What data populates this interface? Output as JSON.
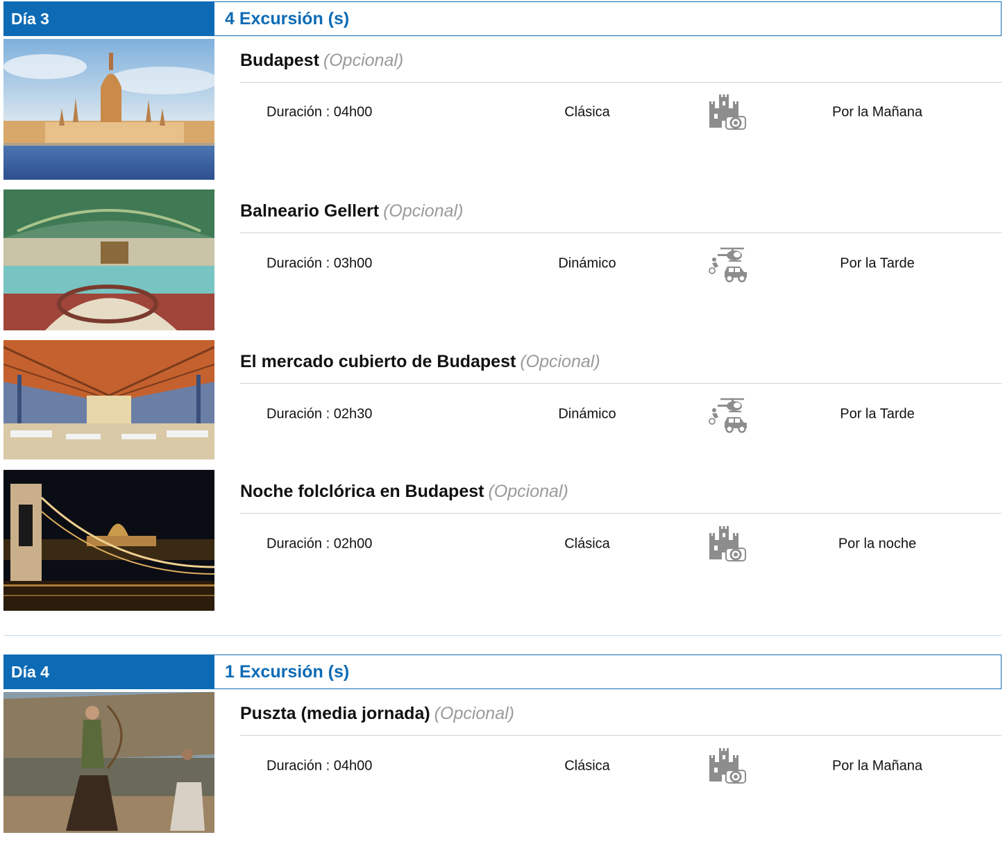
{
  "days": [
    {
      "label": "Día 3",
      "count": "4 Excursión (s)",
      "excursions": [
        {
          "title": "Budapest",
          "optional": "(Opcional)",
          "duration": "Duración : 04h00",
          "type": "Clásica",
          "type_icon": "castle-camera-icon",
          "time": "Por la Mañana",
          "image": "parliament-photo"
        },
        {
          "title": "Balneario Gellert",
          "optional": "(Opcional)",
          "duration": "Duración : 03h00",
          "type": "Dinámico",
          "type_icon": "helicopter-car-icon",
          "time": "Por la Tarde",
          "image": "thermal-bath-photo"
        },
        {
          "title": "El mercado cubierto de Budapest",
          "optional": "(Opcional)",
          "duration": "Duración : 02h30",
          "type": "Dinámico",
          "type_icon": "helicopter-car-icon",
          "time": "Por la Tarde",
          "image": "market-hall-photo"
        },
        {
          "title": "Noche folclórica en Budapest",
          "optional": "(Opcional)",
          "duration": "Duración : 02h00",
          "type": "Clásica",
          "type_icon": "castle-camera-icon",
          "time": "Por la noche",
          "image": "chain-bridge-night-photo"
        }
      ]
    },
    {
      "label": "Día 4",
      "count": "1 Excursión (s)",
      "excursions": [
        {
          "title": "Puszta (media jornada)",
          "optional": "(Opcional)",
          "duration": "Duración : 04h00",
          "type": "Clásica",
          "type_icon": "castle-camera-icon",
          "time": "Por la Mañana",
          "image": "horse-archer-photo"
        }
      ]
    }
  ],
  "colors": {
    "accent": "#0d6bb5",
    "rule": "#d0d0d0",
    "optional_text": "#9a9a9a"
  }
}
